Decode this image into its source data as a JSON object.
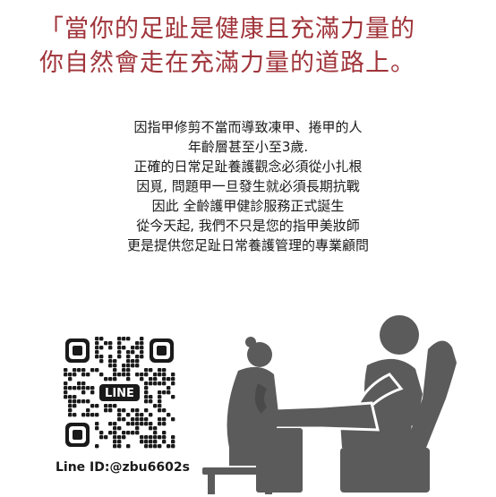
{
  "headline": {
    "line1": "「當你的足趾是健康且充滿力量的",
    "line2": "你自然會走在充滿力量的道路上。"
  },
  "body": {
    "lines": [
      "因指甲修剪不當而導致凍甲、捲甲的人",
      "年齡層甚至小至3歲.",
      "正確的日常足趾養護觀念必須從小扎根",
      "因覓, 問題甲一旦發生就必須長期抗戰",
      "因此 全齡護甲健診服務正式誕生",
      "從今天起, 我們不只是您的指甲美妝師",
      "更是提供您足趾日常養護管理的專業顧問"
    ]
  },
  "qr": {
    "label": "LINE",
    "icon": "qr-code-icon"
  },
  "line_id": {
    "text": "Line ID:@zbu6602s"
  },
  "colors": {
    "headline": "#a0343a",
    "text": "#1a1a1a",
    "figure": "#5b5b5b"
  }
}
